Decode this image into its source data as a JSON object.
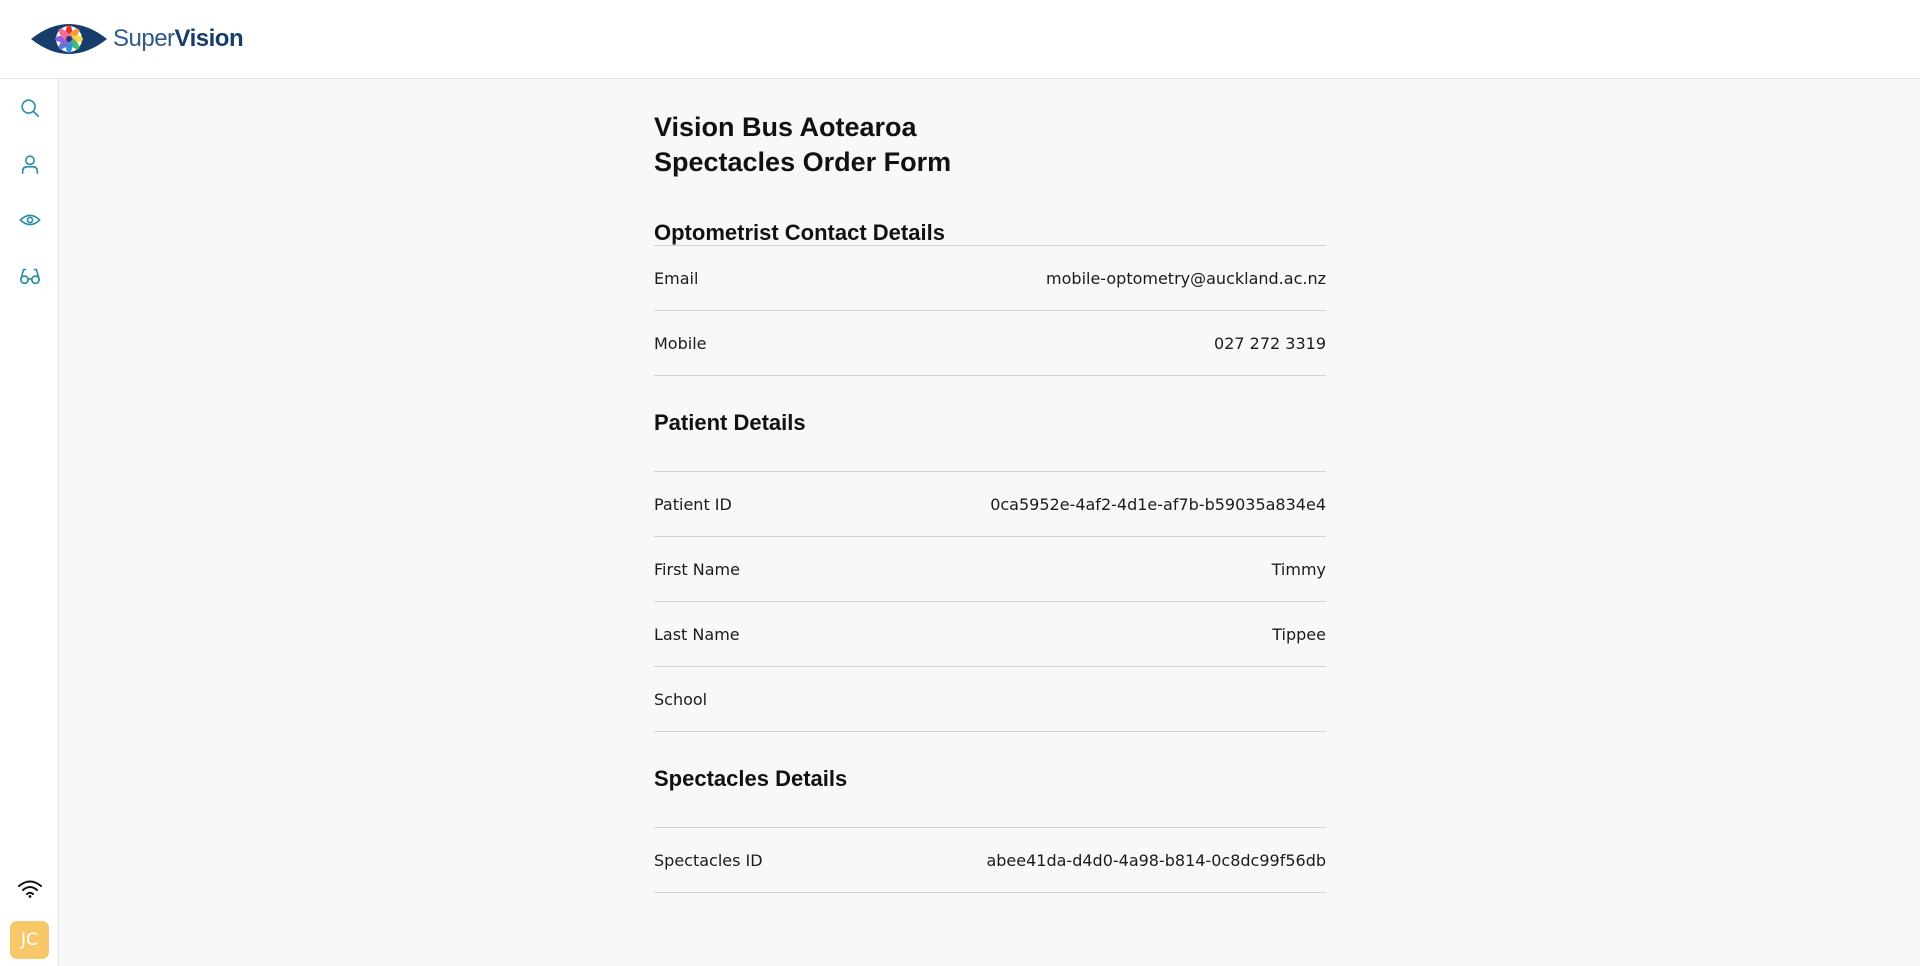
{
  "app": {
    "brand_prefix": "Super",
    "brand_suffix": "Vision"
  },
  "sidebar": {
    "items": [
      {
        "icon": "search-icon"
      },
      {
        "icon": "user-icon"
      },
      {
        "icon": "eye-icon"
      },
      {
        "icon": "glasses-icon"
      }
    ],
    "status_icon": "wifi-icon",
    "avatar_initials": "JC",
    "avatar_color": "#f6c86a",
    "accent_color": "#2b8fa6"
  },
  "page": {
    "title_line1": "Vision Bus Aotearoa",
    "title_line2": "Spectacles Order Form"
  },
  "sections": {
    "optometrist": {
      "heading": "Optometrist Contact Details",
      "rows": [
        {
          "label": "Email",
          "value": "mobile-optometry@auckland.ac.nz"
        },
        {
          "label": "Mobile",
          "value": "027 272 3319"
        }
      ]
    },
    "patient": {
      "heading": "Patient Details",
      "rows": [
        {
          "label": "Patient ID",
          "value": "0ca5952e-4af2-4d1e-af7b-b59035a834e4"
        },
        {
          "label": "First Name",
          "value": "Timmy"
        },
        {
          "label": "Last Name",
          "value": "Tippee"
        },
        {
          "label": "School",
          "value": ""
        }
      ]
    },
    "spectacles": {
      "heading": "Spectacles Details",
      "rows": [
        {
          "label": "Spectacles ID",
          "value": "abee41da-d4d0-4a98-b814-0c8dc99f56db"
        }
      ]
    }
  }
}
